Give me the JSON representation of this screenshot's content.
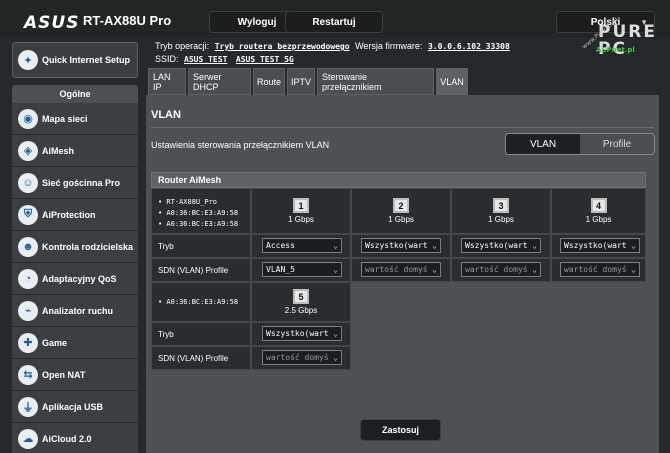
{
  "header": {
    "brand": "ASUS",
    "model": "RT-AX88U Pro",
    "logout_label": "Wyloguj",
    "restart_label": "Restartuj",
    "language": "Polski"
  },
  "info": {
    "mode_label": "Tryb operacji:",
    "mode_value": "Tryb routera bezprzewodowego",
    "firmware_label": "Wersja firmware:",
    "firmware_value": "3.0.0.6.102_33308",
    "ssid_label": "SSID:",
    "ssid_1": "ASUS_TEST",
    "ssid_2": "ASUS_TEST_5G"
  },
  "watermark": {
    "big": "PURE PC",
    "small": "ASPnet.pl",
    "side": "www.PurePC.pl"
  },
  "sidebar": {
    "qis_label": "Quick Internet Setup",
    "section_label": "Ogólne",
    "items": [
      {
        "label": "Mapa sieci",
        "icon": "globe-icon"
      },
      {
        "label": "AiMesh",
        "icon": "aimesh-icon"
      },
      {
        "label": "Sieć gościnna Pro",
        "icon": "guest-network-icon"
      },
      {
        "label": "AiProtection",
        "icon": "shield-icon"
      },
      {
        "label": "Kontrola rodzicielska",
        "icon": "parental-icon"
      },
      {
        "label": "Adaptacyjny QoS",
        "icon": "qos-icon"
      },
      {
        "label": "Analizator ruchu",
        "icon": "traffic-icon"
      },
      {
        "label": "Game",
        "icon": "gamepad-icon"
      },
      {
        "label": "Open NAT",
        "icon": "open-nat-icon"
      },
      {
        "label": "Aplikacja USB",
        "icon": "usb-icon"
      },
      {
        "label": "AiCloud 2.0",
        "icon": "cloud-icon"
      }
    ]
  },
  "tabs": [
    "LAN IP",
    "Serwer DHCP",
    "Route",
    "IPTV",
    "Sterowanie przełącznikiem",
    "VLAN"
  ],
  "active_tab": "VLAN",
  "main": {
    "title": "VLAN",
    "description": "Ustawienia sterowania przełącznikiem VLAN",
    "toggle_vlan": "VLAN",
    "toggle_profile": "Profile",
    "section_header": "Router AiMesh",
    "device_name": "• RT-AX88U_Pro",
    "mac_1": "• A0:36:BC:E3:A9:58",
    "mac_2": "• A0:36:BC:E3:A9:58",
    "mac_3": "• A0:36:BC:E3:A9:58",
    "ports": [
      {
        "num": "1",
        "speed": "1 Gbps",
        "mode": "Access",
        "profile": "VLAN_5"
      },
      {
        "num": "2",
        "speed": "1 Gbps",
        "mode": "Wszystko(wart",
        "profile": "wartość domyś"
      },
      {
        "num": "3",
        "speed": "1 Gbps",
        "mode": "Wszystko(wart",
        "profile": "wartość domyś"
      },
      {
        "num": "4",
        "speed": "1 Gbps",
        "mode": "Wszystko(wart",
        "profile": "wartość domyś"
      },
      {
        "num": "5",
        "speed": "2.5 Gbps",
        "mode": "Wszystko(wart",
        "profile": "wartość domyś"
      }
    ],
    "mode_label": "Tryb",
    "profile_label": "SDN (VLAN) Profile",
    "apply_label": "Zastosuj"
  },
  "colors": {
    "background": "#26292b",
    "panel": "#4d5155",
    "cell": "#2a2d30",
    "watermark_green": "#44c44a"
  }
}
